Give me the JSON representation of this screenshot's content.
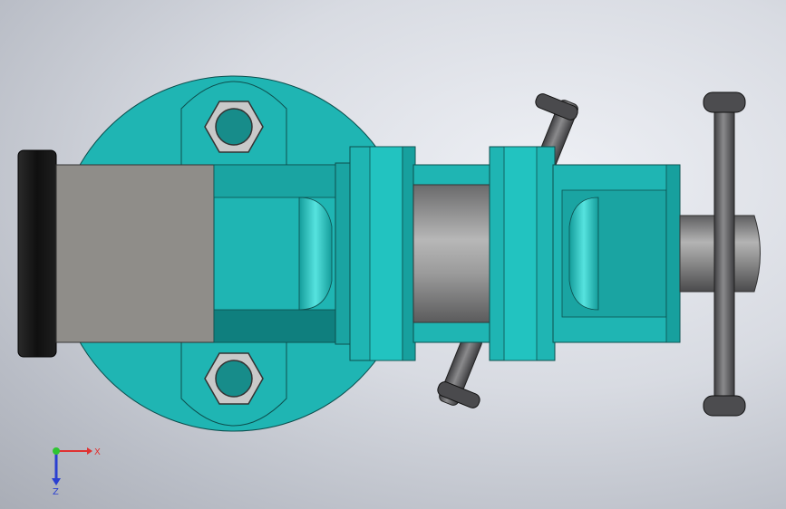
{
  "viewport": {
    "colors": {
      "body": "#1fb5b3",
      "body_dark": "#0f7f7e",
      "body_light": "#3fd8d4",
      "jaw_gray": "#8f8d89",
      "jaw_pad": "#1b1b1b",
      "screw": "#777778",
      "screw_light": "#b0b0b0",
      "handle": "#555558",
      "handle_light": "#7b7b7e",
      "nut_face": "#c9c9c9",
      "nut_hole": "#178c8a"
    }
  },
  "triad": {
    "x_label": "X",
    "y_label": "Z",
    "x_color": "#e03232",
    "y_color": "#2a3fd1",
    "origin_color": "#2ec531"
  }
}
